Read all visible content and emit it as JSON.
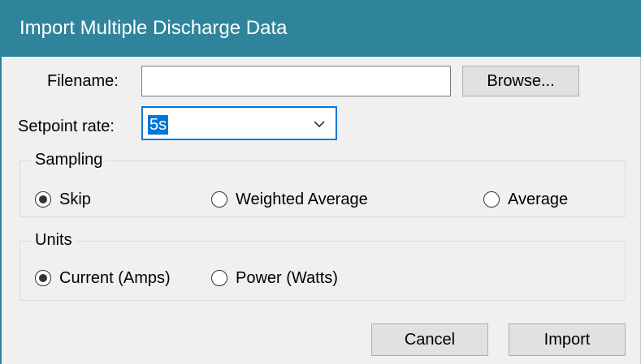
{
  "window": {
    "title": "Import Multiple Discharge Data"
  },
  "filename": {
    "label": "Filename:",
    "value": ""
  },
  "browse": {
    "label": "Browse..."
  },
  "setpoint": {
    "label": "Setpoint rate:",
    "value": "5s"
  },
  "sampling": {
    "legend": "Sampling",
    "options": [
      {
        "label": "Skip",
        "checked": true
      },
      {
        "label": "Weighted Average",
        "checked": false
      },
      {
        "label": "Average",
        "checked": false
      }
    ]
  },
  "units": {
    "legend": "Units",
    "options": [
      {
        "label": "Current (Amps)",
        "checked": true
      },
      {
        "label": "Power (Watts)",
        "checked": false
      }
    ]
  },
  "footer": {
    "cancel_label": "Cancel",
    "import_label": "Import"
  },
  "colors": {
    "titlebar": "#2f849c",
    "accent": "#0078d7"
  }
}
